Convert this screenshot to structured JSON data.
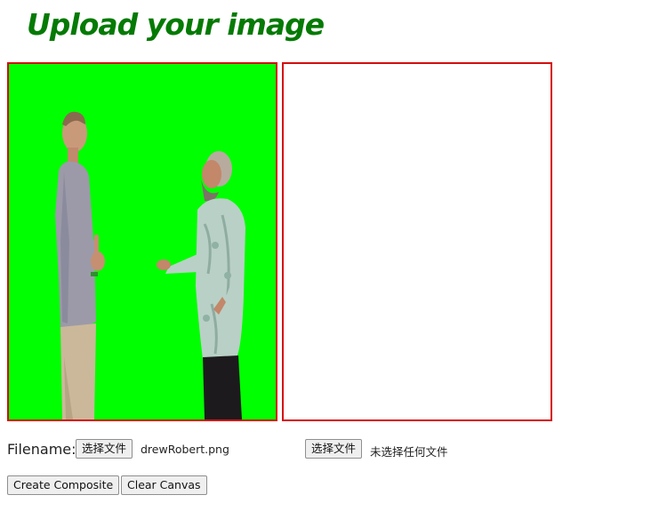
{
  "heading": "Upload your image",
  "upload_row": {
    "filename_label": "Filename:",
    "first_picker": {
      "button_label": "选择文件",
      "selected_file": "drewRobert.png"
    },
    "second_picker": {
      "button_label": "选择文件",
      "selected_file": "未选择任何文件"
    }
  },
  "actions": {
    "create_label": "Create Composite",
    "clear_label": "Clear Canvas"
  },
  "colors": {
    "heading": "#047a04",
    "canvas_border": "#d40d0d",
    "greenscreen": "#00ff00"
  }
}
